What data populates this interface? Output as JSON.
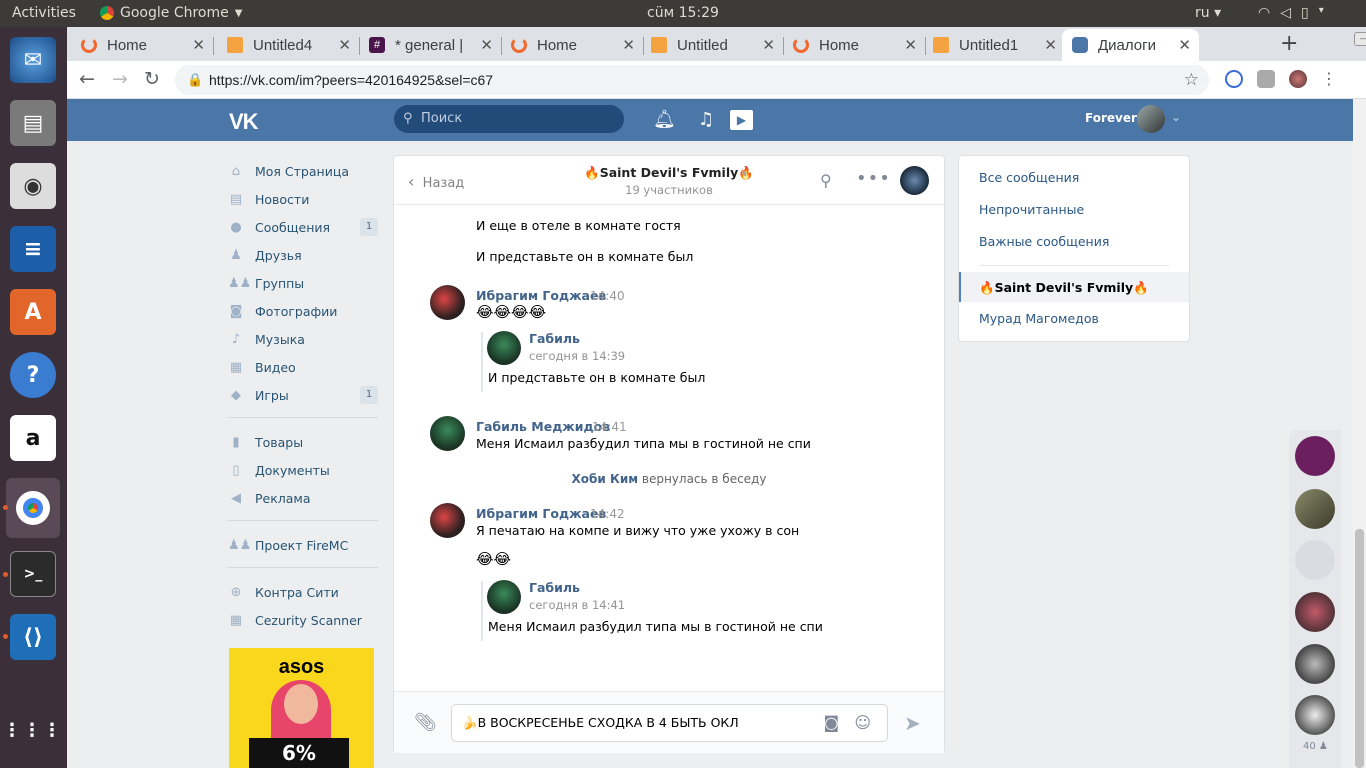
{
  "os": {
    "activities": "Activities",
    "app_name": "Google Chrome",
    "clock": "сüм 15:29",
    "lang": "ru"
  },
  "tabs": [
    {
      "label": "Home",
      "color": "#f26a2d"
    },
    {
      "label": "Untitled4",
      "color": "#f4a340"
    },
    {
      "label": "* general | ",
      "color": "#4a154b"
    },
    {
      "label": "Home",
      "color": "#f26a2d"
    },
    {
      "label": "Untitled",
      "color": "#f4a340"
    },
    {
      "label": "Home",
      "color": "#f26a2d"
    },
    {
      "label": "Untitled1",
      "color": "#f4a340"
    },
    {
      "label": "Диалоги",
      "color": "#4a76a8"
    }
  ],
  "address": {
    "url": "https://vk.com/im?peers=420164925&sel=c67"
  },
  "vk": {
    "search_placeholder": "Поиск",
    "username": "Forever"
  },
  "menu": {
    "items": [
      {
        "label": "Моя Страница",
        "count": ""
      },
      {
        "label": "Новости",
        "count": ""
      },
      {
        "label": "Сообщения",
        "count": "1"
      },
      {
        "label": "Друзья",
        "count": ""
      },
      {
        "label": "Группы",
        "count": ""
      },
      {
        "label": "Фотографии",
        "count": ""
      },
      {
        "label": "Музыка",
        "count": ""
      },
      {
        "label": "Видео",
        "count": ""
      },
      {
        "label": "Игры",
        "count": "1"
      },
      {
        "label": "Товары",
        "count": ""
      },
      {
        "label": "Документы",
        "count": ""
      },
      {
        "label": "Реклама",
        "count": ""
      },
      {
        "label": "Проект FireMC",
        "count": ""
      },
      {
        "label": "Контра Сити",
        "count": ""
      },
      {
        "label": "Cezurity Scanner",
        "count": ""
      }
    ],
    "ad_brand": "asos",
    "ad_percent": "6%"
  },
  "chat": {
    "back_label": "Назад",
    "title": "🔥Saint Devil's Fvmily🔥",
    "members": "19 участников",
    "prev_lines": [
      "И еще в отеле в комнате гостя",
      "И представьте он в комнате был"
    ],
    "msg1": {
      "author": "Ибрагим Годжаев",
      "time": "14:40",
      "emoji": "😂😂😂😂",
      "fwd_author": "Габиль",
      "fwd_time": "сегодня в 14:39",
      "fwd_text": "И представьте он в комнате был"
    },
    "msg2": {
      "author": "Габиль Меджидов",
      "time": "14:41",
      "text": "Меня Исмаил разбудил типа мы в гостиной не спи"
    },
    "service": {
      "name": "Хоби Ким",
      "action": "вернулась в беседу"
    },
    "msg3": {
      "author": "Ибрагим Годжаев",
      "time": "14:42",
      "text": "Я печатаю на компе и вижу что уже ухожу в сон",
      "emoji": "😂😂",
      "fwd_author": "Габиль",
      "fwd_time": "сегодня в 14:41",
      "fwd_text": "Меня Исмаил разбудил типа мы в гостиной не спи"
    },
    "composer_text": "🍌В ВОСКРЕСЕНЬЕ СХОДКА В 4 БЫТЬ ОКЛ"
  },
  "right": {
    "all": "Все сообщения",
    "unread": "Непрочитанные",
    "important": "Важные сообщения",
    "selected": "🔥Saint Devil's Fvmily🔥",
    "other": "Мурад Магомедов"
  },
  "floating": {
    "count": "40"
  },
  "colors": {
    "vk_blue": "#4a76a8",
    "link": "#2a5885",
    "author": "#42648b"
  }
}
